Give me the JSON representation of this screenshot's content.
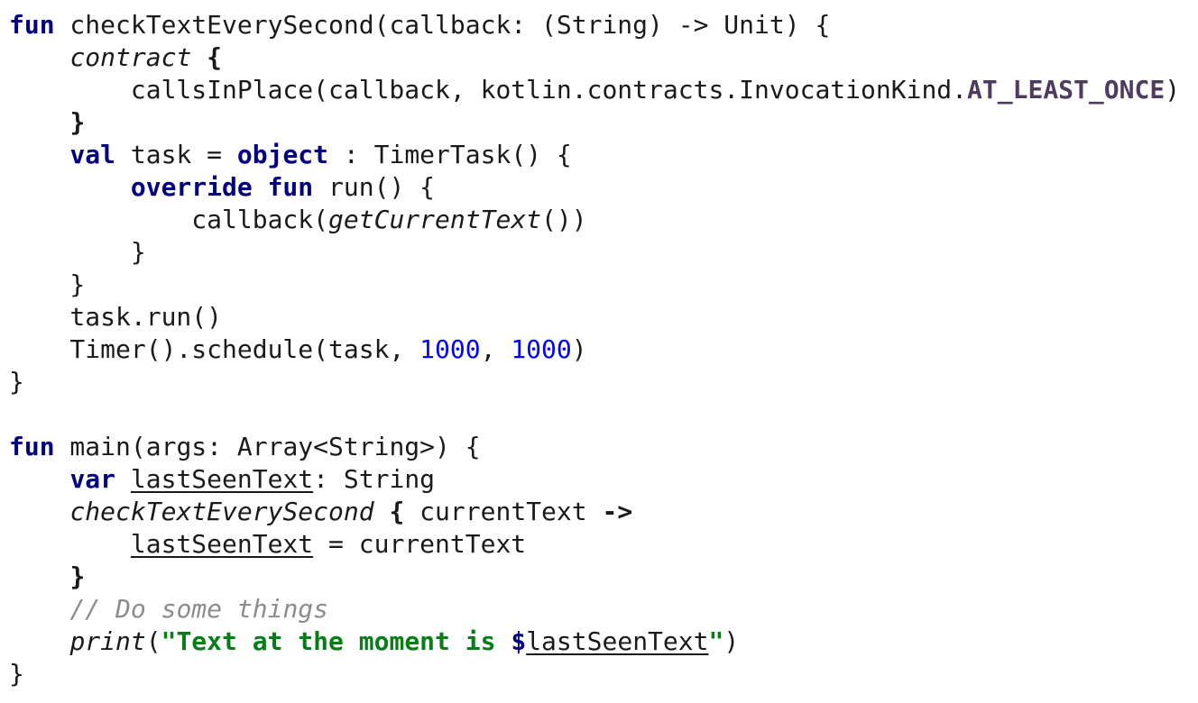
{
  "editor": {
    "language": "Kotlin",
    "colors": {
      "keyword": "#000080",
      "number": "#0000ff",
      "string": "#067d17",
      "comment": "#8c8c8c",
      "enum_constant": "#4f3b5f",
      "plain": "#1a1a1a",
      "background": "#ffffff"
    },
    "lines": [
      [
        {
          "t": "fun",
          "c": "kw"
        },
        {
          "t": " checkTextEverySecond(callback: (String) -> Unit) {"
        }
      ],
      [
        {
          "t": "    "
        },
        {
          "t": "contract",
          "c": "it"
        },
        {
          "t": " "
        },
        {
          "t": "{",
          "c": "brace"
        }
      ],
      [
        {
          "t": "        callsInPlace(callback, kotlin.contracts.InvocationKind."
        },
        {
          "t": "AT_LEAST_ONCE",
          "c": "enumc"
        },
        {
          "t": ")"
        }
      ],
      [
        {
          "t": "    "
        },
        {
          "t": "}",
          "c": "brace"
        }
      ],
      [
        {
          "t": "    "
        },
        {
          "t": "val",
          "c": "kw"
        },
        {
          "t": " task = "
        },
        {
          "t": "object",
          "c": "kw"
        },
        {
          "t": " : TimerTask() {"
        }
      ],
      [
        {
          "t": "        "
        },
        {
          "t": "override",
          "c": "kw"
        },
        {
          "t": " "
        },
        {
          "t": "fun",
          "c": "kw"
        },
        {
          "t": " run() {"
        }
      ],
      [
        {
          "t": "            callback("
        },
        {
          "t": "getCurrentText",
          "c": "it"
        },
        {
          "t": "())"
        }
      ],
      [
        {
          "t": "        }"
        }
      ],
      [
        {
          "t": "    }"
        }
      ],
      [
        {
          "t": "    task.run()"
        }
      ],
      [
        {
          "t": "    Timer().schedule(task, "
        },
        {
          "t": "1000",
          "c": "num"
        },
        {
          "t": ", "
        },
        {
          "t": "1000",
          "c": "num"
        },
        {
          "t": ")"
        }
      ],
      [
        {
          "t": "}"
        }
      ],
      [],
      [
        {
          "t": "fun",
          "c": "kw"
        },
        {
          "t": " main(args: Array<String>) {"
        }
      ],
      [
        {
          "t": "    "
        },
        {
          "t": "var",
          "c": "kw"
        },
        {
          "t": " "
        },
        {
          "t": "lastSeenText",
          "c": "var"
        },
        {
          "t": ": String"
        }
      ],
      [
        {
          "t": "    "
        },
        {
          "t": "checkTextEverySecond",
          "c": "it"
        },
        {
          "t": " "
        },
        {
          "t": "{",
          "c": "brace"
        },
        {
          "t": " currentText "
        },
        {
          "t": "->",
          "c": "brace"
        }
      ],
      [
        {
          "t": "        "
        },
        {
          "t": "lastSeenText",
          "c": "var"
        },
        {
          "t": " = currentText"
        }
      ],
      [
        {
          "t": "    "
        },
        {
          "t": "}",
          "c": "brace"
        }
      ],
      [
        {
          "t": "    "
        },
        {
          "t": "// Do some things",
          "c": "cmt"
        }
      ],
      [
        {
          "t": "    "
        },
        {
          "t": "print",
          "c": "it"
        },
        {
          "t": "("
        },
        {
          "t": "\"Text at the moment is ",
          "c": "str"
        },
        {
          "t": "$",
          "c": "tmpl"
        },
        {
          "t": "lastSeenText",
          "c": "var"
        },
        {
          "t": "\"",
          "c": "str"
        },
        {
          "t": ")"
        }
      ],
      [
        {
          "t": "}"
        }
      ]
    ]
  }
}
